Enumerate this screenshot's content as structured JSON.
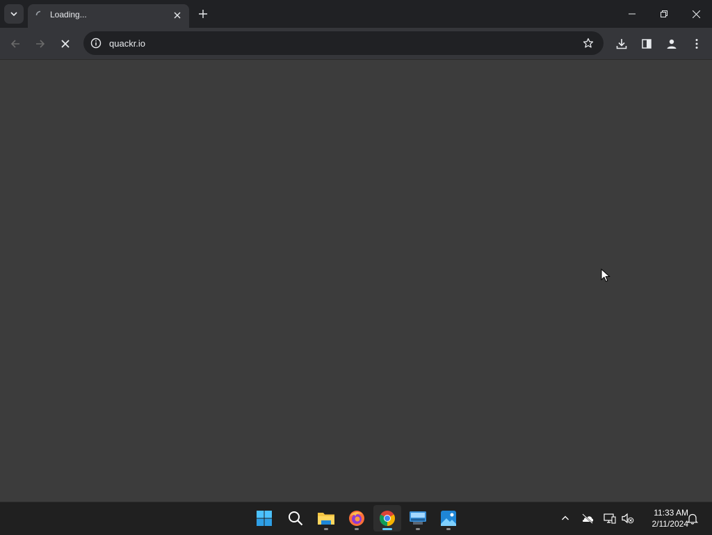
{
  "browser": {
    "tab": {
      "title": "Loading...",
      "icon": "loading-spinner-icon"
    },
    "new_tab_icon": "plus-icon",
    "window_controls": [
      "minimize-icon",
      "restore-icon",
      "close-icon"
    ],
    "toolbar": {
      "back_icon": "arrow-left-icon",
      "forward_icon": "arrow-right-icon",
      "stop_icon": "stop-x-icon",
      "url": "quackr.io",
      "site_info_icon": "info-icon",
      "bookmark_icon": "star-icon",
      "download_icon": "download-icon",
      "side_panel_icon": "side-panel-icon",
      "profile_icon": "person-icon",
      "menu_icon": "kebab-menu-icon"
    },
    "colors": {
      "tabstrip": "#202124",
      "toolbar": "#35363a",
      "content": "#3c3c3c"
    }
  },
  "taskbar": {
    "apps": [
      {
        "name": "start",
        "icon": "windows-logo-icon"
      },
      {
        "name": "search",
        "icon": "search-icon"
      },
      {
        "name": "file-explorer",
        "icon": "folder-icon",
        "running": true
      },
      {
        "name": "firefox",
        "icon": "firefox-icon",
        "running": true
      },
      {
        "name": "chrome",
        "icon": "chrome-icon",
        "running": true,
        "active": true
      },
      {
        "name": "keyboard-app",
        "icon": "keyboard-monitor-icon",
        "running": true
      },
      {
        "name": "photos",
        "icon": "photos-icon",
        "running": true
      }
    ],
    "tray_icons": [
      "chevron-up-icon",
      "onedrive-offline-icon",
      "network-icon",
      "volume-muted-icon"
    ],
    "time": "11:33 AM",
    "date": "2/11/2024",
    "notification_icon": "bell-icon"
  }
}
